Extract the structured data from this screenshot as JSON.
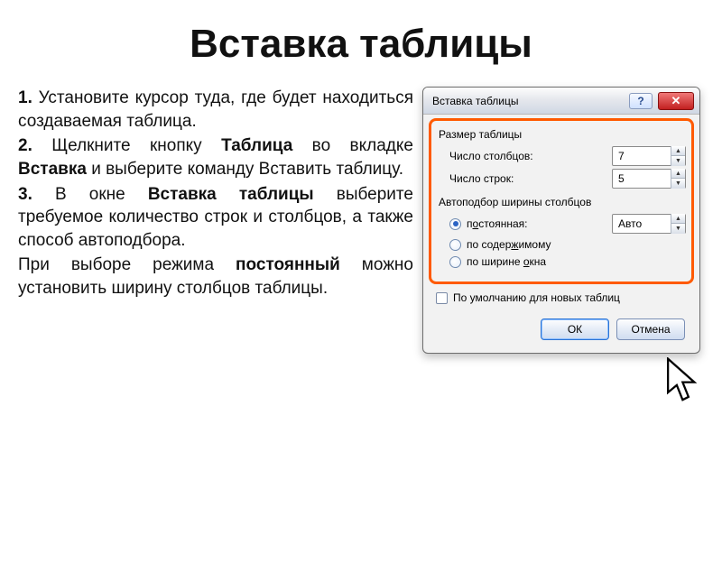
{
  "title": "Вставка таблицы",
  "text": {
    "s1_num": "1.",
    "s1": " Установите курсор туда, где будет находиться создаваемая таблица.",
    "s2_num": "2.",
    "s2a": " Щелкните кнопку ",
    "s2_tablica": "Таблица",
    "s2b": " во вкладке ",
    "s2_vstavka": "Вставка",
    "s2c": " и выберите команду Вставить таблицу.",
    "s3_num": "3.",
    "s3a": " В окне ",
    "s3_win": "Вставка таблицы",
    "s3b": " выберите требуемое количество строк и столбцов, а также способ автоподбора.",
    "s4a": "При выборе режима ",
    "s4_mode": "постоянный",
    "s4b": " можно установить ширину столбцов таблицы."
  },
  "dialog": {
    "title": "Вставка таблицы",
    "help": "?",
    "close": "✕",
    "size_label": "Размер таблицы",
    "cols_label": "Число столбцов:",
    "cols_value": "7",
    "rows_label": "Число строк:",
    "rows_value": "5",
    "autofit_label": "Автоподбор ширины столбцов",
    "opt_fixed_pre": "п",
    "opt_fixed_u": "о",
    "opt_fixed_post": "стоянная:",
    "opt_fixed_value": "Авто",
    "opt_content_pre": "по содер",
    "opt_content_u": "ж",
    "opt_content_post": "имому",
    "opt_window_pre": "по ширине ",
    "opt_window_u": "о",
    "opt_window_post": "кна",
    "default_label": "По умолчанию для новых таблиц",
    "ok": "ОК",
    "cancel": "Отмена"
  }
}
